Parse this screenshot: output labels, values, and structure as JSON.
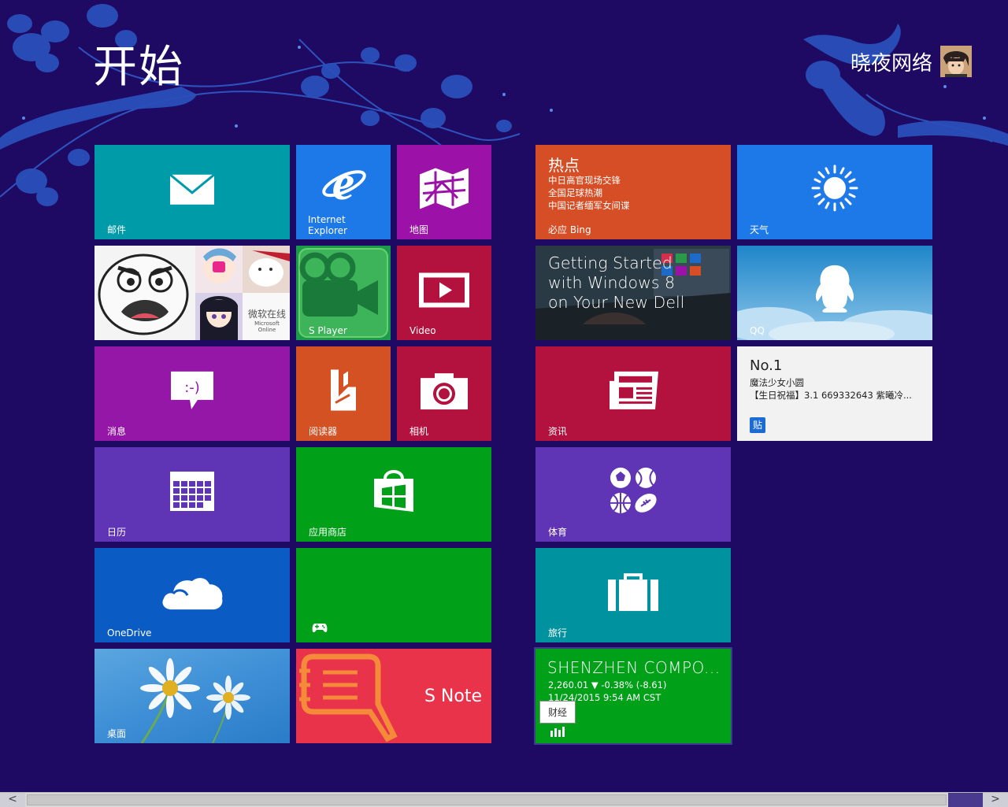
{
  "start": {
    "title": "开始"
  },
  "user": {
    "name": "晓夜网络",
    "avatar_icon": "user-avatar"
  },
  "colors": {
    "background": "#1f0a63",
    "teal": "#009ba8",
    "blue": "#1e79e8",
    "magenta": "#9c12a8",
    "orange": "#d64e25",
    "crimson": "#b4123e",
    "green": "#00a018",
    "purple": "#5f34b5"
  },
  "tiles": {
    "mail": {
      "label": "邮件",
      "icon": "envelope-icon"
    },
    "ie": {
      "label_line1": "Internet",
      "label_line2": "Explorer",
      "icon": "internet-explorer-icon"
    },
    "maps": {
      "label": "地图",
      "icon": "map-icon"
    },
    "news_hot": {
      "title": "热点",
      "lines": [
        "中日高官现场交锋",
        "全国足球热潮",
        "中国记者缅军女间谍"
      ],
      "label": "必应 Bing"
    },
    "weather": {
      "label": "天气",
      "icon": "sun-icon"
    },
    "people": {
      "caption": "微软在线",
      "caption_sub": "Microsoft Online"
    },
    "splayer": {
      "label": "S Player",
      "icon": "video-camera-icon"
    },
    "video": {
      "label": "Video",
      "icon": "play-icon"
    },
    "dell": {
      "line1": "Getting Started",
      "line2": "with Windows 8",
      "line3": "on Your New Dell"
    },
    "qq": {
      "label": "QQ",
      "icon": "qq-penguin-icon"
    },
    "messaging": {
      "label": "消息",
      "icon": "chat-bubble-icon"
    },
    "reader": {
      "label": "阅读器",
      "icon": "reader-icon"
    },
    "camera": {
      "label": "相机",
      "icon": "camera-icon"
    },
    "news": {
      "label": "资讯",
      "icon": "newspaper-icon"
    },
    "tieba": {
      "rank": "No.1",
      "line1": "魔法少女小圆",
      "line2": "【生日祝福】3.1 669332643 紫曦冷...",
      "badge": "贴"
    },
    "calendar": {
      "label": "日历",
      "icon": "calendar-icon"
    },
    "store": {
      "label": "应用商店",
      "icon": "store-bag-icon"
    },
    "sports": {
      "label": "体育",
      "icon": "sports-balls-icon"
    },
    "onedrive": {
      "label": "OneDrive",
      "icon": "cloud-icon"
    },
    "games": {
      "icon": "gamepad-icon"
    },
    "travel": {
      "label": "旅行",
      "icon": "suitcase-icon"
    },
    "desktop": {
      "label": "桌面"
    },
    "snote": {
      "label": "S Note",
      "icon": "snote-icon"
    },
    "finance": {
      "title": "SHENZHEN COMPO...",
      "line1": "2,260.01 ▼ -0.38% (-8.61)",
      "line2": "11/24/2015 9:54 AM CST",
      "tooltip": "财经",
      "icon": "finance-chart-icon"
    }
  },
  "scrollbar": {
    "left_arrow": "<",
    "right_arrow": ">"
  }
}
